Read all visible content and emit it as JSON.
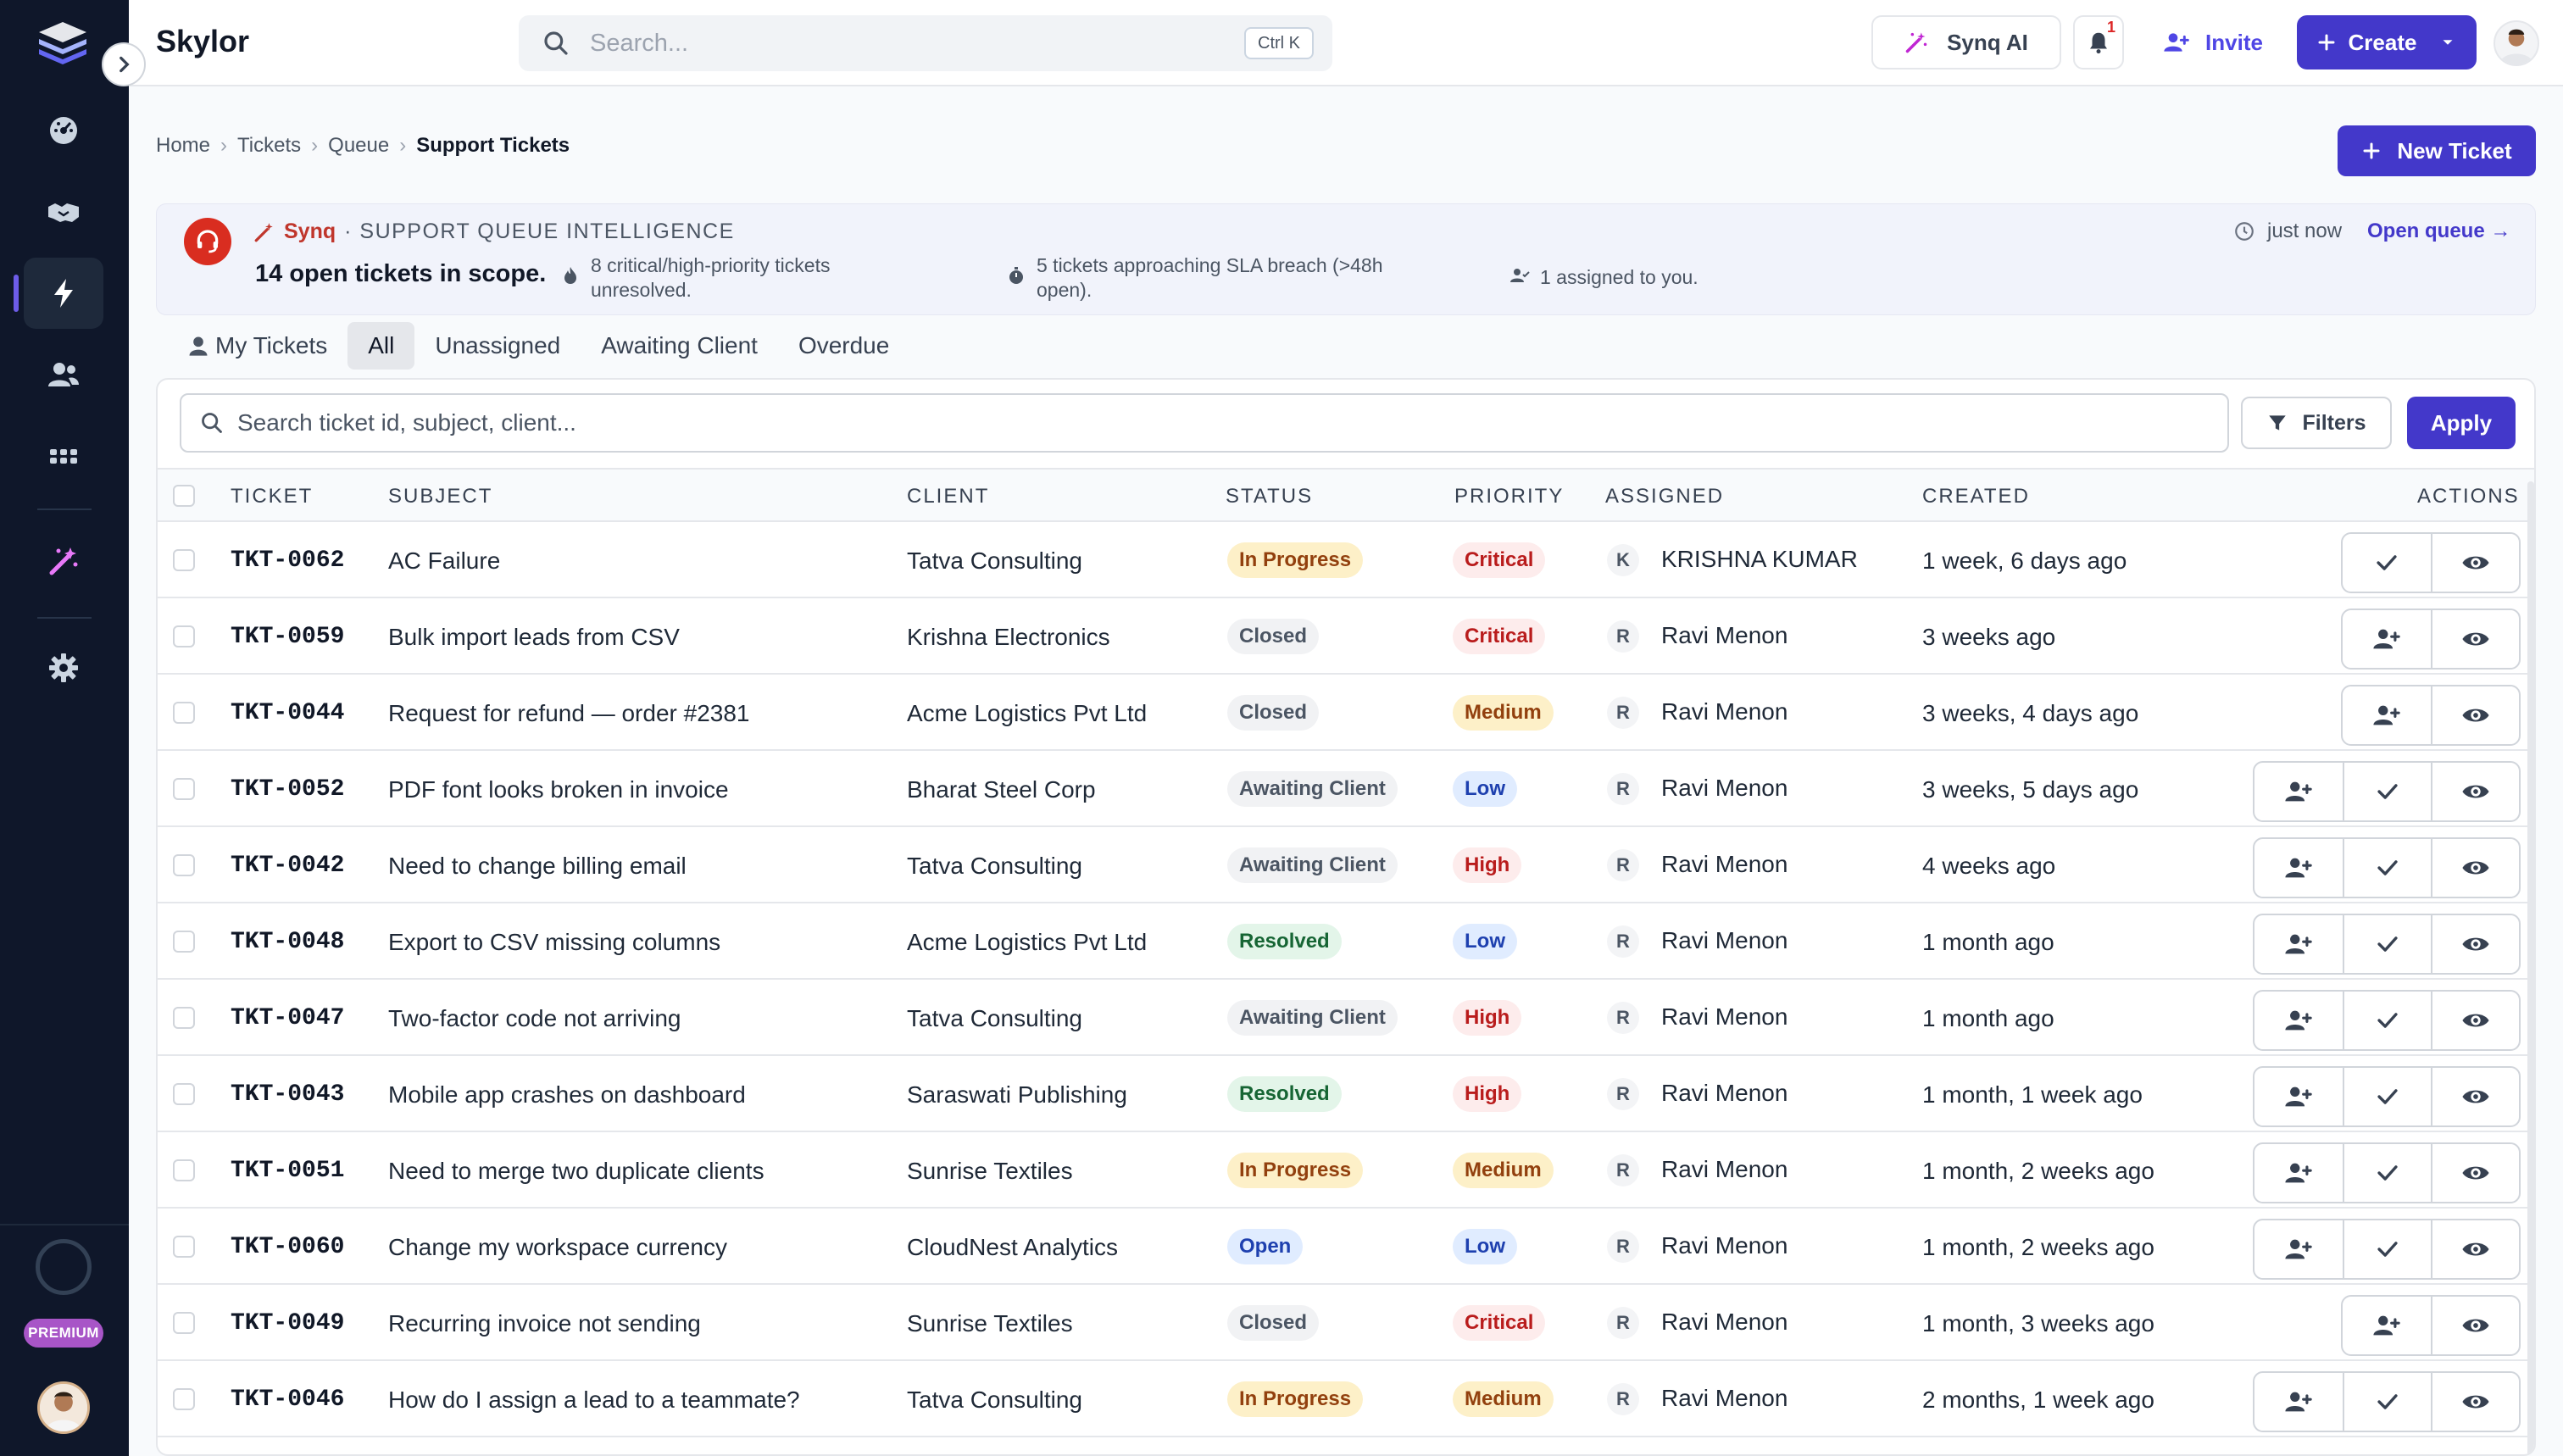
{
  "app": {
    "brand": "Skylor"
  },
  "search": {
    "placeholder": "Search...",
    "shortcut": "Ctrl K"
  },
  "topbar": {
    "synq_ai": "Synq AI",
    "notif_count": "1",
    "invite": "Invite",
    "create": "Create"
  },
  "breadcrumb": [
    "Home",
    "Tickets",
    "Queue",
    "Support Tickets"
  ],
  "new_ticket": "New Ticket",
  "banner": {
    "brand": "Synq",
    "label": "· SUPPORT QUEUE INTELLIGENCE",
    "scope": "14 open tickets in scope.",
    "stats": [
      "8 critical/high-priority tickets unresolved.",
      "5 tickets approaching SLA breach (>48h open).",
      "1 assigned to you."
    ],
    "time": "just now",
    "open_queue": "Open queue →"
  },
  "tabs": [
    "My Tickets",
    "All",
    "Unassigned",
    "Awaiting Client",
    "Overdue"
  ],
  "table_search": {
    "placeholder": "Search ticket id, subject, client..."
  },
  "filters": "Filters",
  "apply": "Apply",
  "columns": [
    "TICKET",
    "SUBJECT",
    "CLIENT",
    "STATUS",
    "PRIORITY",
    "ASSIGNED",
    "CREATED",
    "ACTIONS"
  ],
  "rows": [
    {
      "id": "TKT-0062",
      "subject": "AC Failure",
      "client": "Tatva Consulting",
      "status": "In Progress",
      "priority": "Critical",
      "initial": "K",
      "assigned": "KRISHNA KUMAR",
      "created": "1 week, 6 days ago",
      "actions": [
        "check",
        "view"
      ]
    },
    {
      "id": "TKT-0059",
      "subject": "Bulk import leads from CSV",
      "client": "Krishna Electronics",
      "status": "Closed",
      "priority": "Critical",
      "initial": "R",
      "assigned": "Ravi Menon",
      "created": "3 weeks ago",
      "actions": [
        "assign",
        "view"
      ]
    },
    {
      "id": "TKT-0044",
      "subject": "Request for refund — order #2381",
      "client": "Acme Logistics Pvt Ltd",
      "status": "Closed",
      "priority": "Medium",
      "initial": "R",
      "assigned": "Ravi Menon",
      "created": "3 weeks, 4 days ago",
      "actions": [
        "assign",
        "view"
      ]
    },
    {
      "id": "TKT-0052",
      "subject": "PDF font looks broken in invoice",
      "client": "Bharat Steel Corp",
      "status": "Awaiting Client",
      "priority": "Low",
      "initial": "R",
      "assigned": "Ravi Menon",
      "created": "3 weeks, 5 days ago",
      "actions": [
        "assign",
        "check",
        "view"
      ]
    },
    {
      "id": "TKT-0042",
      "subject": "Need to change billing email",
      "client": "Tatva Consulting",
      "status": "Awaiting Client",
      "priority": "High",
      "initial": "R",
      "assigned": "Ravi Menon",
      "created": "4 weeks ago",
      "actions": [
        "assign",
        "check",
        "view"
      ]
    },
    {
      "id": "TKT-0048",
      "subject": "Export to CSV missing columns",
      "client": "Acme Logistics Pvt Ltd",
      "status": "Resolved",
      "priority": "Low",
      "initial": "R",
      "assigned": "Ravi Menon",
      "created": "1 month ago",
      "actions": [
        "assign",
        "check",
        "view"
      ]
    },
    {
      "id": "TKT-0047",
      "subject": "Two-factor code not arriving",
      "client": "Tatva Consulting",
      "status": "Awaiting Client",
      "priority": "High",
      "initial": "R",
      "assigned": "Ravi Menon",
      "created": "1 month ago",
      "actions": [
        "assign",
        "check",
        "view"
      ]
    },
    {
      "id": "TKT-0043",
      "subject": "Mobile app crashes on dashboard",
      "client": "Saraswati Publishing",
      "status": "Resolved",
      "priority": "High",
      "initial": "R",
      "assigned": "Ravi Menon",
      "created": "1 month, 1 week ago",
      "actions": [
        "assign",
        "check",
        "view"
      ]
    },
    {
      "id": "TKT-0051",
      "subject": "Need to merge two duplicate clients",
      "client": "Sunrise Textiles",
      "status": "In Progress",
      "priority": "Medium",
      "initial": "R",
      "assigned": "Ravi Menon",
      "created": "1 month, 2 weeks ago",
      "actions": [
        "assign",
        "check",
        "view"
      ]
    },
    {
      "id": "TKT-0060",
      "subject": "Change my workspace currency",
      "client": "CloudNest Analytics",
      "status": "Open",
      "priority": "Low",
      "initial": "R",
      "assigned": "Ravi Menon",
      "created": "1 month, 2 weeks ago",
      "actions": [
        "assign",
        "check",
        "view"
      ]
    },
    {
      "id": "TKT-0049",
      "subject": "Recurring invoice not sending",
      "client": "Sunrise Textiles",
      "status": "Closed",
      "priority": "Critical",
      "initial": "R",
      "assigned": "Ravi Menon",
      "created": "1 month, 3 weeks ago",
      "actions": [
        "assign",
        "view"
      ]
    },
    {
      "id": "TKT-0046",
      "subject": "How do I assign a lead to a teammate?",
      "client": "Tatva Consulting",
      "status": "In Progress",
      "priority": "Medium",
      "initial": "R",
      "assigned": "Ravi Menon",
      "created": "2 months, 1 week ago",
      "actions": [
        "assign",
        "check",
        "view"
      ]
    }
  ],
  "status_colors": {
    "In Progress": {
      "bg": "#fdf0c8",
      "fg": "#92400e"
    },
    "Closed": {
      "bg": "#f1f2f4",
      "fg": "#4b5563"
    },
    "Awaiting Client": {
      "bg": "#f1f2f4",
      "fg": "#4b5563"
    },
    "Resolved": {
      "bg": "#e3f5e9",
      "fg": "#166534"
    },
    "Open": {
      "bg": "#e0ecff",
      "fg": "#1e40af"
    }
  },
  "priority_colors": {
    "Critical": {
      "bg": "#fdecec",
      "fg": "#b91c1c"
    },
    "High": {
      "bg": "#fdecec",
      "fg": "#b91c1c"
    },
    "Medium": {
      "bg": "#fdf0c8",
      "fg": "#92400e"
    },
    "Low": {
      "bg": "#e0ecff",
      "fg": "#1e40af"
    }
  },
  "sidebar_premium": "PREMIUM"
}
